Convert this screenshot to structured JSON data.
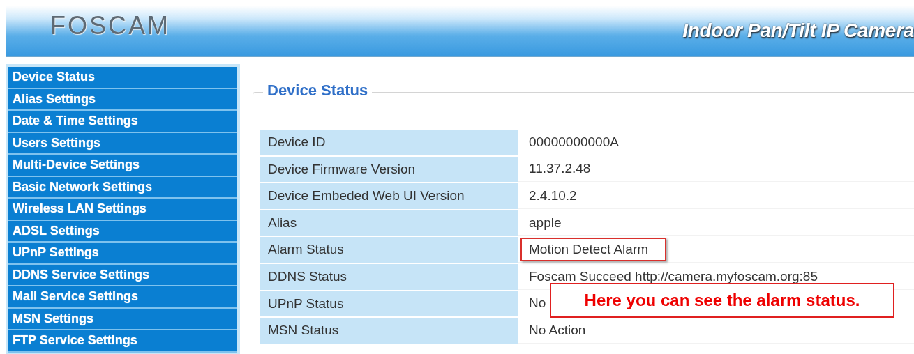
{
  "header": {
    "logo": "FOSCAM",
    "product": "Indoor Pan/Tilt IP Camera"
  },
  "sidebar": {
    "items": [
      "Device Status",
      "Alias Settings",
      "Date & Time Settings",
      "Users Settings",
      "Multi-Device Settings",
      "Basic Network Settings",
      "Wireless LAN Settings",
      "ADSL Settings",
      "UPnP Settings",
      "DDNS Service Settings",
      "Mail Service Settings",
      "MSN Settings",
      "FTP Service Settings"
    ]
  },
  "panel": {
    "title": "Device Status",
    "rows": [
      {
        "label": "Device ID",
        "value": "00000000000A",
        "highlighted": false
      },
      {
        "label": "Device Firmware Version",
        "value": "11.37.2.48",
        "highlighted": false
      },
      {
        "label": "Device Embeded Web UI Version",
        "value": "2.4.10.2",
        "highlighted": false
      },
      {
        "label": "Alias",
        "value": "apple",
        "highlighted": false
      },
      {
        "label": "Alarm Status",
        "value": "Motion Detect Alarm",
        "highlighted": true
      },
      {
        "label": "DDNS Status",
        "value": "Foscam Succeed  http://camera.myfoscam.org:85",
        "highlighted": false
      },
      {
        "label": "UPnP Status",
        "value": "No",
        "highlighted": false
      },
      {
        "label": "MSN Status",
        "value": "No Action",
        "highlighted": false
      }
    ]
  },
  "callout": {
    "text": "Here you can see the alarm status."
  }
}
